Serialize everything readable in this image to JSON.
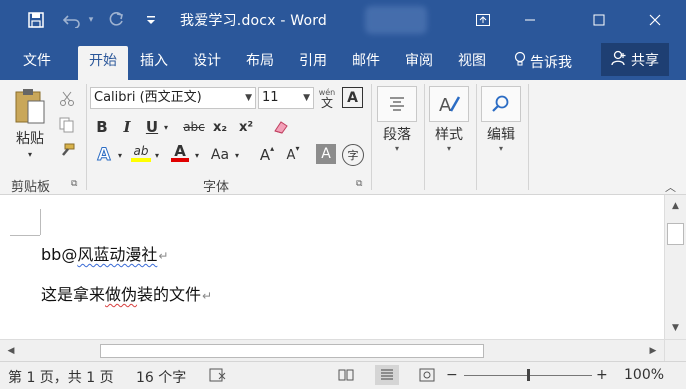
{
  "titlebar": {
    "title": "我爱学习.docx - Word",
    "save_icon": "save-icon",
    "undo_icon": "undo-icon",
    "redo_icon": "redo-icon",
    "customize_icon": "customize-qat-icon",
    "ribbon_display_icon": "ribbon-display-icon",
    "minimize_icon": "minimize-icon",
    "maximize_icon": "maximize-icon",
    "close_icon": "close-icon",
    "bg_color": "#2b579a"
  },
  "tabs": [
    {
      "label": "文件"
    },
    {
      "label": "开始",
      "active": true
    },
    {
      "label": "插入"
    },
    {
      "label": "设计"
    },
    {
      "label": "布局"
    },
    {
      "label": "引用"
    },
    {
      "label": "邮件"
    },
    {
      "label": "审阅"
    },
    {
      "label": "视图"
    },
    {
      "label": "告诉我"
    }
  ],
  "share_label": "共享",
  "ribbon": {
    "clipboard": {
      "paste_label": "粘贴",
      "group_label": "剪贴板"
    },
    "font": {
      "font_name": "Calibri (西文正文)",
      "font_size": "11",
      "phonetic_label": "wén",
      "phonetic_char": "文",
      "bold": "B",
      "italic": "I",
      "underline": "U",
      "strike": "abc",
      "subscript": "x₂",
      "superscript": "x²",
      "highlight": "ab",
      "font_color": "A",
      "change_case": "Aa",
      "grow": "A",
      "shrink": "A",
      "char_shading": "A",
      "enclose": "字",
      "group_label": "字体"
    },
    "paragraph_label": "段落",
    "styles_label": "样式",
    "editing_label": "编辑"
  },
  "document": {
    "line1_prefix": "bb@",
    "line1_squiggle": "风蓝动漫社",
    "line2_prefix": "这是拿来",
    "line2_squiggle": "做伪",
    "line2_suffix": "装的文件",
    "para_mark": "↵"
  },
  "status": {
    "page": "第 1 页，共 1 页",
    "words": "16 个字",
    "zoom": "100%",
    "zoom_out": "−",
    "zoom_in": "+",
    "zoom_level": 1.0
  }
}
